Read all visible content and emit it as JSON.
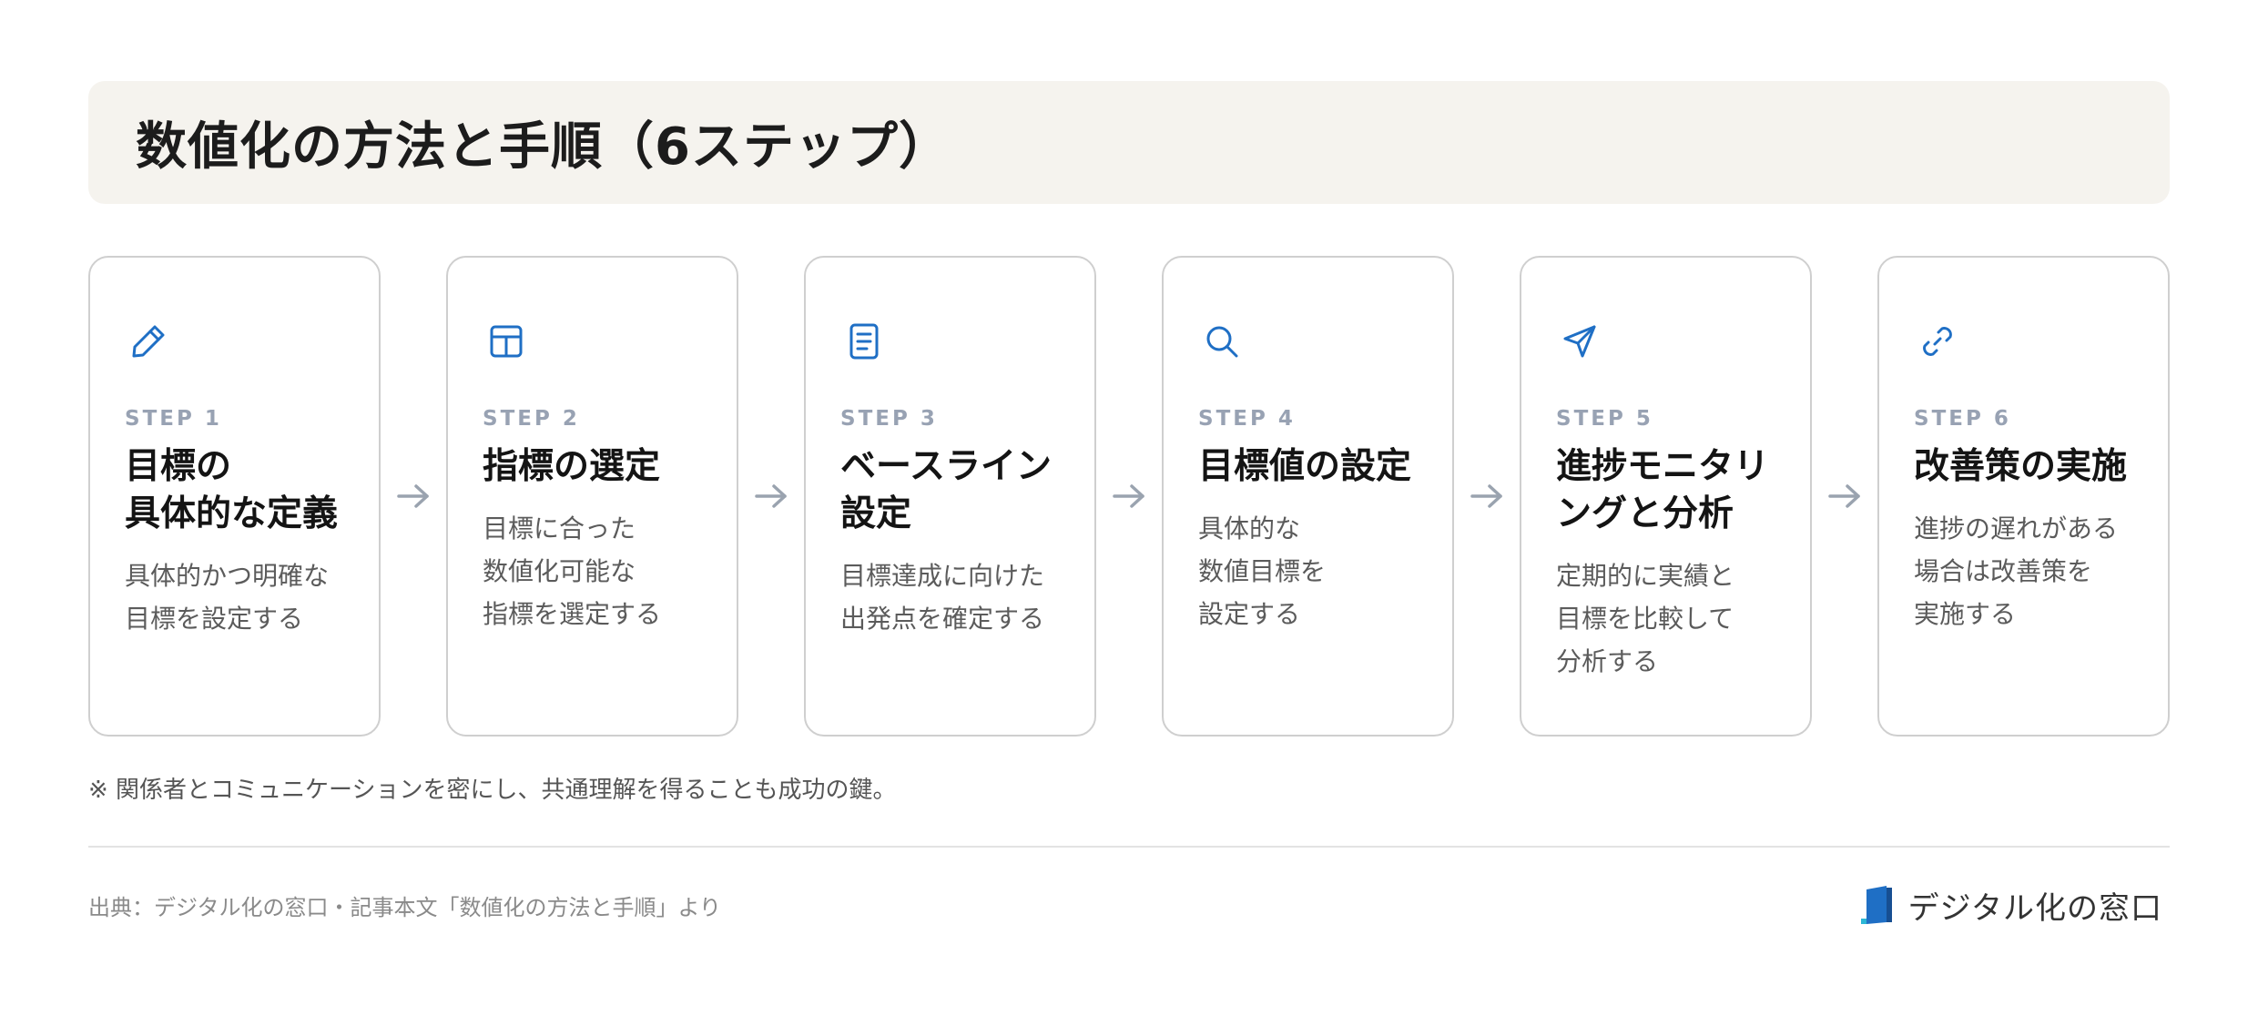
{
  "header": {
    "title": "数値化の方法と手順（6ステップ）"
  },
  "colors": {
    "accent": "#1f6fc5",
    "arrow": "#9aa3af",
    "step_label": "#98a2b3",
    "title_bg": "#f5f3ee"
  },
  "steps": [
    {
      "icon": "pencil-icon",
      "label": "STEP 1",
      "title": "目標の\n具体的な定義",
      "desc": "具体的かつ明確な\n目標を設定する"
    },
    {
      "icon": "table-icon",
      "label": "STEP 2",
      "title": "指標の選定",
      "desc": "目標に合った\n数値化可能な\n指標を選定する"
    },
    {
      "icon": "document-icon",
      "label": "STEP 3",
      "title": "ベースライン\n設定",
      "desc": "目標達成に向けた\n出発点を確定する"
    },
    {
      "icon": "search-icon",
      "label": "STEP 4",
      "title": "目標値の設定",
      "desc": "具体的な\n数値目標を\n設定する"
    },
    {
      "icon": "send-icon",
      "label": "STEP 5",
      "title": "進捗モニタリ\nングと分析",
      "desc": "定期的に実績と\n目標を比較して\n分析する"
    },
    {
      "icon": "link-icon",
      "label": "STEP 6",
      "title": "改善策の実施",
      "desc": "進捗の遅れがある\n場合は改善策を\n実施する"
    }
  ],
  "note": "※ 関係者とコミュニケーションを密にし、共通理解を得ることも成功の鍵。",
  "footer": {
    "source": "出典：デジタル化の窓口・記事本文「数値化の方法と手順」より",
    "brand": "デジタル化の窓口",
    "brand_icon": "brand-logo-icon"
  }
}
